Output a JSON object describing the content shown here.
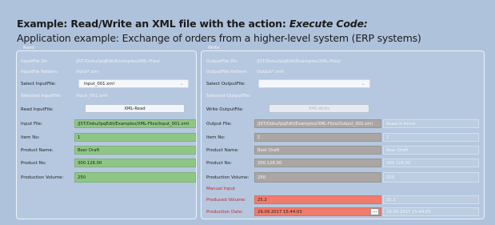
{
  "header": {
    "title_prefix": "Example: Read/Write an XML file with the action: ",
    "title_emph": "Execute Code:",
    "subtitle": "Application example: Exchange of orders from a higher-level system (ERP systems)"
  },
  "read": {
    "title": "Read",
    "inputfile_dir_label": "InputFile Dir:",
    "inputfile_dir_value": "/JST/Doku/IpqEdit/Examples/XML-Files/",
    "inputfile_pattern_label": "InputFile Pattern:",
    "inputfile_pattern_value": "Input*.xml",
    "select_inputfile_label": "Select InputFile:",
    "select_inputfile_value": "Input_001.xml",
    "selected_inputfile_label": "Selected InputFile:",
    "selected_inputfile_value": "Input_001.xml",
    "read_inputfile_label": "Read InputFile:",
    "read_button": "XML-Read",
    "input_file_label": "Input File:",
    "input_file_value": "/JST/Doku/IpqEdit/Examples/XML-Files/Input_001.xml",
    "item_no_label": "Item No:",
    "item_no_value": "1",
    "product_name_label": "Product Name:",
    "product_name_value": "Beer Draft",
    "product_no_label": "Product No:",
    "product_no_value": "300.128.00",
    "production_volume_label": "Production Volume:",
    "production_volume_value": "250"
  },
  "write": {
    "title": "Write",
    "outputfile_dir_label": "OutputFile Dir:",
    "outputfile_dir_value": "/JST/Doku/IpqEdit/Examples/XML-Files/",
    "outputfile_pattern_label": "OutputFile Pattern:",
    "outputfile_pattern_value": "Output*.xml",
    "select_outputfile_label": "Select OutputFile:",
    "select_outputfile_value": "",
    "selected_outputfile_label": "Selected OutputFile:",
    "write_outputfile_label": "Write OutputFile:",
    "write_button": "XML-Write",
    "output_file_label": "Output File:",
    "output_file_value": "/JST/Doku/IpqEdit/Examples/XML-Files/Output_002.xml",
    "output_file_hint": "Read-in Items",
    "item_no_label": "Item No:",
    "item_no_value": "1",
    "item_no_ghost": "1",
    "product_name_label": "Product Name:",
    "product_name_value": "Beer Draft",
    "product_name_ghost": "Beer Draft",
    "product_no_label": "Product No:",
    "product_no_value": "300.128.00",
    "product_no_ghost": "300.128.00",
    "production_volume_label": "Production Volume:",
    "production_volume_value": "250",
    "production_volume_ghost": "250",
    "manual_input_label": "Manual Input",
    "produced_volume_label": "Produced Volume:",
    "produced_volume_value": "25.2",
    "produced_volume_ghost": "25.2",
    "production_date_label": "Production Date:",
    "production_date_value": "29.09.2017 15:44:03",
    "production_date_ghost": "29.09.2017 15:44:03",
    "dots_button": "..."
  },
  "colors": {
    "background": "#aec2dc",
    "filled_field": "#8fc685",
    "readonly_field": "#a9a6a3",
    "manual_field": "#f07c6d",
    "manual_label": "#d02424"
  }
}
